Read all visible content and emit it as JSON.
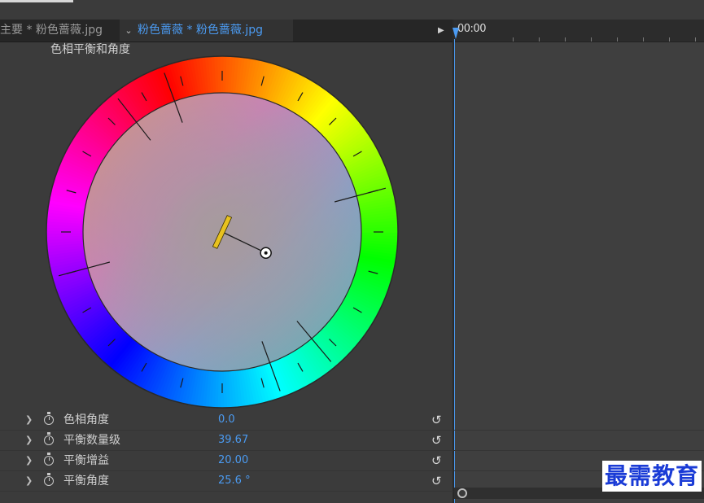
{
  "tabs": {
    "main_label": "主要 * 粉色蔷薇.jpg",
    "clip_label": "粉色蔷薇 * 粉色蔷薇.jpg"
  },
  "timeline": {
    "timecode": "00:00"
  },
  "panel": {
    "title": "色相平衡和角度"
  },
  "wheel": {
    "hue_angle_deg": 0.0,
    "balance_angle_deg": 25.6,
    "balance_magnitude": 39.67,
    "balance_gain": 20.0
  },
  "properties": [
    {
      "label": "色相角度",
      "value": "0.0"
    },
    {
      "label": "平衡数量级",
      "value": "39.67"
    },
    {
      "label": "平衡增益",
      "value": "20.00"
    },
    {
      "label": "平衡角度",
      "value": "25.6 °"
    }
  ],
  "watermark": "最需教育",
  "icons": {
    "twirl": "chevron-right-icon",
    "stopwatch": "stopwatch-icon",
    "reset": "reset-icon"
  },
  "colors": {
    "accent": "#4b9bf2",
    "panel_bg": "#3b3b3b",
    "tab_bg": "#262626",
    "indicator": "#e8c21f"
  }
}
